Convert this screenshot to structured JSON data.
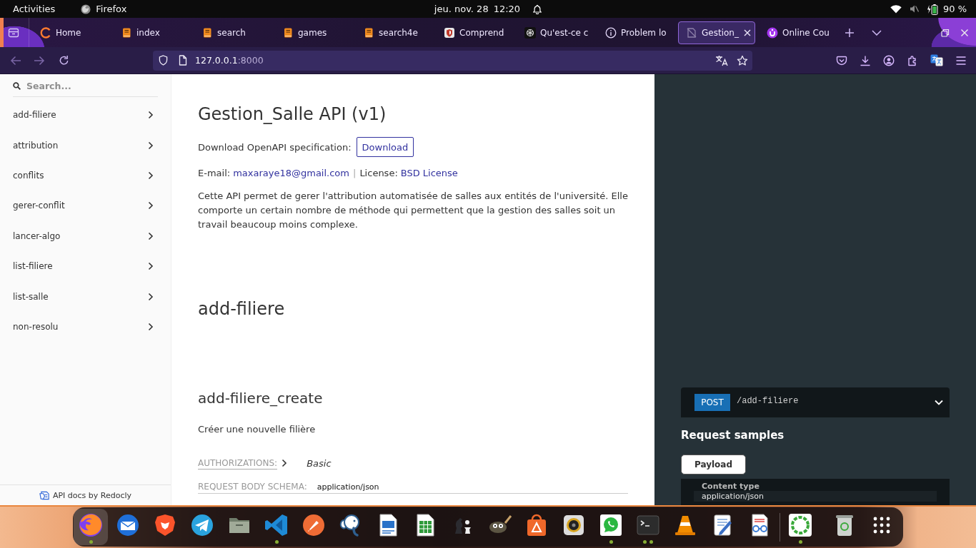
{
  "top_bar": {
    "activities": "Activities",
    "app_name": "Firefox",
    "date": "jeu. nov. 28",
    "time": "12:20",
    "battery": "90 %"
  },
  "browser": {
    "tabs": [
      {
        "kind": "home",
        "label": "Home",
        "selected": false
      },
      {
        "kind": "book",
        "label": "index",
        "selected": false
      },
      {
        "kind": "book",
        "label": "search",
        "selected": false
      },
      {
        "kind": "book",
        "label": "games",
        "selected": false
      },
      {
        "kind": "book",
        "label": "search4e",
        "selected": false
      },
      {
        "kind": "badge",
        "label": "Comprend",
        "selected": false
      },
      {
        "kind": "knot",
        "label": "Qu'est-ce c",
        "selected": false
      },
      {
        "kind": "info",
        "label": "Problem lo",
        "selected": false
      },
      {
        "kind": "docs",
        "label": "Gestion_",
        "selected": true
      },
      {
        "kind": "letter",
        "label": "Online Cou",
        "selected": false
      }
    ],
    "address": {
      "host": "127.0.0.1",
      "port": ":8000"
    }
  },
  "sidebar": {
    "search": {
      "placeholder": "Search..."
    },
    "items": [
      {
        "label": "add-filiere",
        "selected": false,
        "expanded": false
      },
      {
        "label": "attribution",
        "selected": false,
        "expanded": false
      },
      {
        "label": "conflits",
        "selected": false,
        "expanded": false
      },
      {
        "label": "gerer-conflit",
        "selected": false,
        "expanded": false
      },
      {
        "label": "lancer-algo",
        "selected": false,
        "expanded": false
      },
      {
        "label": "list-filiere",
        "selected": false,
        "expanded": false
      },
      {
        "label": "list-salle",
        "selected": false,
        "expanded": false
      },
      {
        "label": "non-resolu",
        "selected": false,
        "expanded": false
      }
    ],
    "footer": "API docs by Redocly"
  },
  "info": {
    "title": "Gestion_Salle API (v1)",
    "download_label": "Download OpenAPI specification:",
    "download_button": "Download",
    "email_label": "E-mail:",
    "email": "maxaraye18@gmail.com",
    "separator": "|",
    "license_label": "License:",
    "license": "BSD License",
    "description": "Cette API permet de gerer l'attribution automatisée de salles aux entités de l'université. Elle comporte un certain nombre de méthode qui permettent que la gestion des salles soit un travail beaucoup moins complexe."
  },
  "section": {
    "title": "add-filiere",
    "operation": {
      "title": "add-filiere_create",
      "summary": "Créer une nouvelle filière",
      "authorizations_label": "AUTHORIZATIONS:",
      "authorizations": "Basic",
      "body_schema_label": "REQUEST BODY SCHEMA:",
      "body_schema": "application/json"
    }
  },
  "samples": {
    "method": "POST",
    "path": "/add-filiere",
    "expanded": false,
    "heading": "Request samples",
    "tabs": [
      {
        "label": "Payload",
        "selected": true
      }
    ],
    "content_type_label": "Content type",
    "content_type": "application/json"
  },
  "dock": {
    "pinned": [
      {
        "kind": "browser",
        "focused": true,
        "running": true,
        "multiple_windows": false
      },
      {
        "kind": "mail",
        "focused": false,
        "running": false,
        "multiple_windows": false
      },
      {
        "kind": "lion",
        "focused": false,
        "running": false,
        "multiple_windows": false
      },
      {
        "kind": "plane",
        "focused": false,
        "running": false,
        "multiple_windows": false
      },
      {
        "kind": "folder",
        "focused": false,
        "running": false,
        "multiple_windows": false
      },
      {
        "kind": "code",
        "focused": false,
        "running": true,
        "multiple_windows": false
      },
      {
        "kind": "rocket",
        "focused": false,
        "running": false,
        "multiple_windows": false
      },
      {
        "kind": "elephant",
        "focused": false,
        "running": false,
        "multiple_windows": false
      },
      {
        "kind": "writer",
        "focused": false,
        "running": false,
        "multiple_windows": false
      },
      {
        "kind": "calc",
        "focused": false,
        "running": false,
        "multiple_windows": false
      },
      {
        "kind": "chess",
        "focused": false,
        "running": false,
        "multiple_windows": false
      },
      {
        "kind": "brush",
        "focused": false,
        "running": false,
        "multiple_windows": false
      },
      {
        "kind": "store",
        "focused": false,
        "running": false,
        "multiple_windows": false
      },
      {
        "kind": "speaker",
        "focused": false,
        "running": false,
        "multiple_windows": false
      },
      {
        "kind": "chat",
        "focused": false,
        "running": true,
        "multiple_windows": false
      },
      {
        "kind": "terminal",
        "focused": false,
        "running": true,
        "multiple_windows": true
      },
      {
        "kind": "cone",
        "focused": false,
        "running": false,
        "multiple_windows": false
      },
      {
        "kind": "editor",
        "focused": false,
        "running": false,
        "multiple_windows": false
      },
      {
        "kind": "viewer",
        "focused": false,
        "running": false,
        "multiple_windows": false
      }
    ],
    "others": [
      {
        "kind": "ring",
        "focused": false,
        "running": true,
        "multiple_windows": false
      },
      {
        "kind": "trash",
        "focused": false,
        "running": false,
        "multiple_windows": false
      },
      {
        "kind": "grid",
        "focused": false,
        "running": false,
        "multiple_windows": false
      }
    ]
  }
}
